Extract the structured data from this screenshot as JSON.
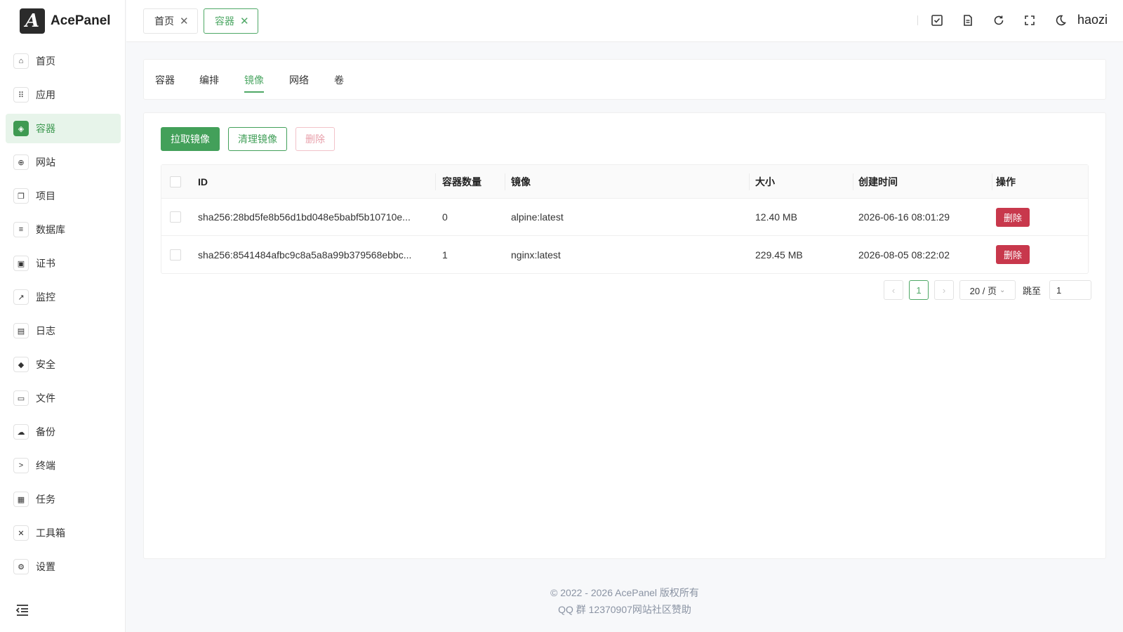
{
  "brand": {
    "logo_letter": "A",
    "name": "AcePanel"
  },
  "sidebar": {
    "items": [
      {
        "label": "首页",
        "icon": "home-icon",
        "glyph": "⌂"
      },
      {
        "label": "应用",
        "icon": "apps-grid-icon",
        "glyph": "⠿"
      },
      {
        "label": "容器",
        "icon": "container-icon",
        "glyph": "◈",
        "active": true
      },
      {
        "label": "网站",
        "icon": "globe-icon",
        "glyph": "⊕"
      },
      {
        "label": "项目",
        "icon": "project-icon",
        "glyph": "❐"
      },
      {
        "label": "数据库",
        "icon": "database-icon",
        "glyph": "≡"
      },
      {
        "label": "证书",
        "icon": "certificate-icon",
        "glyph": "▣"
      },
      {
        "label": "监控",
        "icon": "monitor-chart-icon",
        "glyph": "↗"
      },
      {
        "label": "日志",
        "icon": "log-file-icon",
        "glyph": "▤"
      },
      {
        "label": "安全",
        "icon": "shield-icon",
        "glyph": "◆"
      },
      {
        "label": "文件",
        "icon": "folder-icon",
        "glyph": "▭"
      },
      {
        "label": "备份",
        "icon": "cloud-backup-icon",
        "glyph": "☁"
      },
      {
        "label": "终端",
        "icon": "terminal-icon",
        "glyph": ">"
      },
      {
        "label": "任务",
        "icon": "task-icon",
        "glyph": "▦"
      },
      {
        "label": "工具箱",
        "icon": "toolbox-icon",
        "glyph": "✕"
      },
      {
        "label": "设置",
        "icon": "settings-gear-icon",
        "glyph": "⚙"
      }
    ]
  },
  "topbar": {
    "tabs": [
      {
        "label": "首页",
        "active": false
      },
      {
        "label": "容器",
        "active": true
      }
    ],
    "user": "haozi"
  },
  "subtabs": [
    {
      "label": "容器",
      "active": false
    },
    {
      "label": "编排",
      "active": false
    },
    {
      "label": "镜像",
      "active": true
    },
    {
      "label": "网络",
      "active": false
    },
    {
      "label": "卷",
      "active": false
    }
  ],
  "actions": {
    "pull": "拉取镜像",
    "prune": "清理镜像",
    "delete": "删除"
  },
  "table": {
    "columns": {
      "id": "ID",
      "count": "容器数量",
      "image": "镜像",
      "size": "大小",
      "created": "创建时间",
      "ops": "操作"
    },
    "rows": [
      {
        "id": "sha256:28bd5fe8b56d1bd048e5babf5b10710e...",
        "count": "0",
        "image": "alpine:latest",
        "size": "12.40 MB",
        "created": "2026-06-16 08:01:29",
        "op": "删除"
      },
      {
        "id": "sha256:8541484afbc9c8a5a8a99b379568ebbc...",
        "count": "1",
        "image": "nginx:latest",
        "size": "229.45 MB",
        "created": "2026-08-05 08:22:02",
        "op": "删除"
      }
    ]
  },
  "pagination": {
    "page": "1",
    "page_size": "20 / 页",
    "jump_label": "跳至",
    "jump_value": "1"
  },
  "footer": {
    "copyright": "© 2022 - 2026 AcePanel 版权所有",
    "qq": "QQ 群 12370907",
    "links": [
      "网站",
      "社区",
      "赞助"
    ]
  }
}
